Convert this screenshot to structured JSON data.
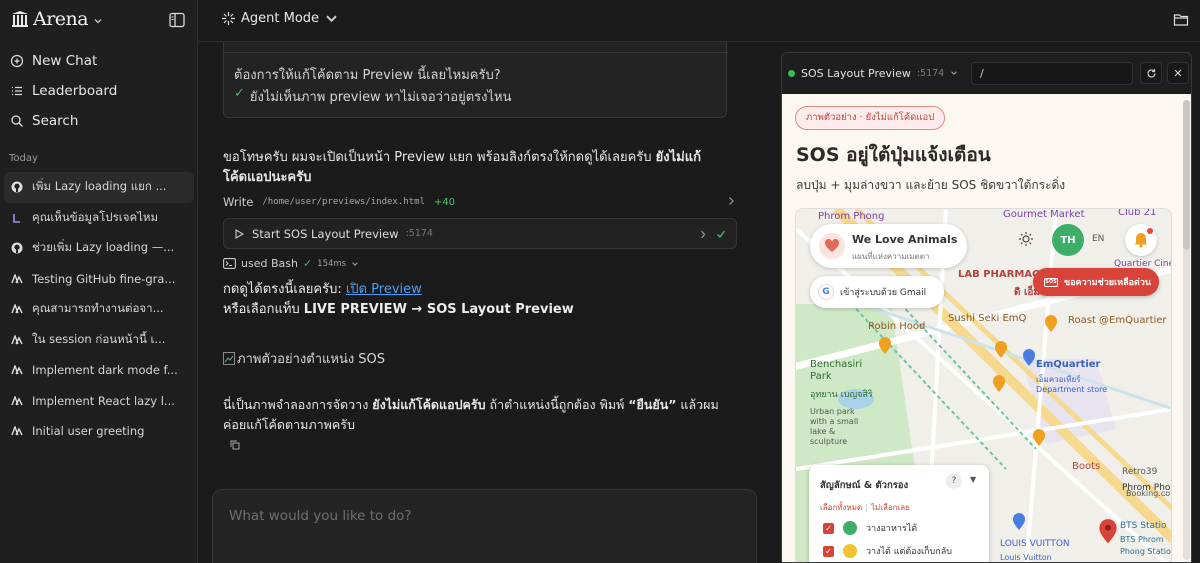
{
  "sidebar": {
    "brand": "Arena",
    "nav": [
      {
        "label": "New Chat",
        "icon": "plus-circle-icon"
      },
      {
        "label": "Leaderboard",
        "icon": "list-icon"
      },
      {
        "label": "Search",
        "icon": "search-icon"
      }
    ],
    "section": "Today",
    "history": [
      {
        "label": "เพิ่ม Lazy loading แยก ...",
        "icon": "github-icon"
      },
      {
        "label": "คุณเห็นข้อมูลโปรเจคไหม",
        "icon": "linear-icon"
      },
      {
        "label": "ช่วยเพิ่ม Lazy loading —...",
        "icon": "github-icon"
      },
      {
        "label": "Testing GitHub fine-gra...",
        "icon": "arena-icon"
      },
      {
        "label": "คุณสามารถทำงานต่อจา...",
        "icon": "arena-icon"
      },
      {
        "label": "ใน session ก่อนหน้านี้ เ...",
        "icon": "arena-icon"
      },
      {
        "label": "Implement dark mode f...",
        "icon": "arena-icon"
      },
      {
        "label": "Implement React lazy l...",
        "icon": "arena-icon"
      },
      {
        "label": "Initial user greeting",
        "icon": "arena-icon"
      }
    ]
  },
  "topbar": {
    "mode": "Agent Mode"
  },
  "chat": {
    "prev_question": "ต้องการให้แก้โค้ดตาม Preview นี้เลยไหมครับ?",
    "prev_answer": "ยังไม่เห็นภาพ preview หาไม่เจอว่าอยู่ตรงไหน",
    "msg1_plain": "ขอโทษครับ ผมจะเปิดเป็นหน้า Preview แยก พร้อมลิงก์ตรงให้กดดูได้เลยครับ ",
    "msg1_bold": "ยังไม่แก้โค้ดแอปนะครับ",
    "write_label": "Write",
    "write_path": "/home/user/previews/index.html",
    "write_diff": "+40",
    "start_label": "Start SOS Layout Preview",
    "start_port": ":5174",
    "bash_label": "used Bash",
    "bash_time": "154ms",
    "link_prefix": "กดดูได้ตรงนี้เลยครับ: ",
    "link_text": "เปิด Preview",
    "tab_prefix": "หรือเลือกแท็บ ",
    "tab_bold": "LIVE PREVIEW → SOS Layout Preview",
    "broken_img_alt": "ภาพตัวอย่างตำแหน่ง SOS",
    "msg2_a": "นี่เป็นภาพจำลองการจัดวาง ",
    "msg2_b": "ยังไม่แก้โค้ดแอปครับ",
    "msg2_c": " ถ้าตำแหน่งนี้ถูกต้อง พิมพ์ ",
    "msg2_d": "“ยืนยัน”",
    "msg2_e": " แล้วผมค่อยแก้โค้ดตามภาพครับ",
    "composer_placeholder": "What would you like to do?"
  },
  "preview": {
    "title": "SOS Layout Preview",
    "port": ":5174",
    "url": "/",
    "pill": "ภาพตัวอย่าง · ยังไม่แก้โค้ดแอป",
    "heading": "SOS อยู่ใต้ปุ่มแจ้งเตือน",
    "subheading": "ลบปุ่ม + มุมล่างขวา และย้าย SOS ชิดขวาใต้กระดิ่ง",
    "map": {
      "brand": "We Love Animals",
      "brand_sub": "แผนที่แห่งความเมตตา",
      "avatar": "TH",
      "lang": "EN",
      "gmail_label": "เข้าสู่ระบบด้วย Gmail",
      "gmail_g": "G",
      "sos_label": "ขอความช่วยเหลือด่วน",
      "sos_badge": "SOS",
      "places": [
        "Phrom Phong",
        "Gourmet Market",
        "Club 21",
        "Quartier CineArt",
        "LAB PHARMAC",
        "ดิ เอ็ม",
        "Sushi Seki EmQ",
        "Roast @EmQuartier",
        "Robin Hood",
        "Benchasiri Park",
        "อุทยาน เบญจสิริ",
        "Urban park with a small lake & sculpture",
        "EmQuartier",
        "เอ็มควอเทียร์",
        "Department store",
        "Boots",
        "Retro39",
        "Booking.co",
        "Phrom Phon",
        "BTS Statio",
        "BTS Phrom",
        "Phong Statio",
        "LOUIS VUITTON",
        "Louis Vuitton"
      ],
      "legend": {
        "title": "สัญลักษณ์ & ตัวกรอง",
        "q": "?",
        "select_all": "เลือกทั้งหมด",
        "select_none": "ไม่เลือกเลย",
        "rows": [
          {
            "label": "วางอาหารได้",
            "color": "#3cae68"
          },
          {
            "label": "วางได้ แต่ต้องเก็บกลับ",
            "color": "#f2c230"
          }
        ]
      }
    }
  },
  "colors": {
    "accent_green": "#48b56a",
    "link_blue": "#4a9ff5",
    "sos_red": "#d8433a"
  }
}
